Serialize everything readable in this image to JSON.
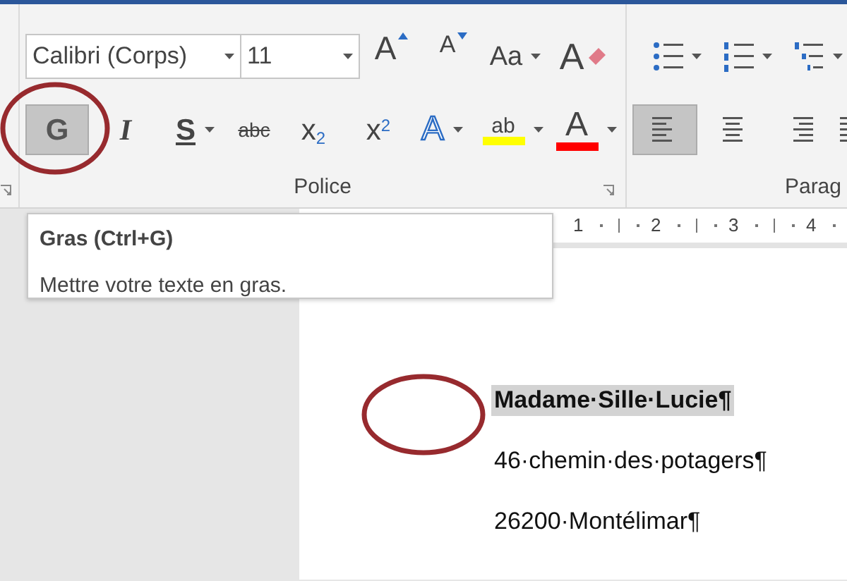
{
  "ribbon": {
    "font_name": "Calibri (Corps)",
    "font_size": "11",
    "font_tools": [
      {
        "kind": "grow",
        "label": "A"
      },
      {
        "kind": "shrink",
        "label": "A"
      },
      {
        "kind": "case",
        "label": "Aa",
        "dropdown": true
      },
      {
        "kind": "clear",
        "label": "A"
      }
    ],
    "format_tools": [
      {
        "kind": "bold",
        "label": "G",
        "selected": true
      },
      {
        "kind": "italic",
        "label": "I",
        "selected": false
      },
      {
        "kind": "underline",
        "label": "S",
        "selected": false,
        "dropdown": true
      },
      {
        "kind": "strike",
        "label": "abc",
        "selected": false
      },
      {
        "kind": "script",
        "label": "x$_{2}$",
        "selected": false
      },
      {
        "kind": "script",
        "label": "x$^{2}$",
        "selected": false
      },
      {
        "kind": "effects",
        "label": "A",
        "selected": false,
        "dropdown": true
      },
      {
        "kind": "highlight",
        "label": "ab",
        "selected": false,
        "dropdown": true,
        "color": "#ffff00"
      },
      {
        "kind": "fontcolor",
        "label": "A",
        "selected": false,
        "dropdown": true,
        "color": "#ff0000"
      }
    ],
    "font_group_label": "Police",
    "paragraph_tools": [
      {
        "kind": "bullets",
        "dropdown": true
      },
      {
        "kind": "numbering",
        "dropdown": true
      },
      {
        "kind": "multilevel",
        "dropdown": true
      }
    ],
    "paragraph_align": [
      {
        "kind": "left",
        "selected": true
      },
      {
        "kind": "center",
        "selected": false
      },
      {
        "kind": "right",
        "selected": false
      },
      {
        "kind": "justify",
        "selected": false
      }
    ],
    "paragraph_group_label": "Parag"
  },
  "tooltip": {
    "title": "Gras (Ctrl+G)",
    "description": "Mettre votre texte en gras."
  },
  "ruler": {
    "numbers": [
      "1",
      "2",
      "3",
      "4"
    ]
  },
  "document": {
    "lines": [
      {
        "text": "Madame·Sille·Lucie¶",
        "bold": true,
        "selected": true
      },
      {
        "text": "46·chemin·des·potagers¶",
        "bold": false,
        "selected": false
      },
      {
        "text": "26200·Montélimar¶",
        "bold": false,
        "selected": false
      }
    ]
  }
}
